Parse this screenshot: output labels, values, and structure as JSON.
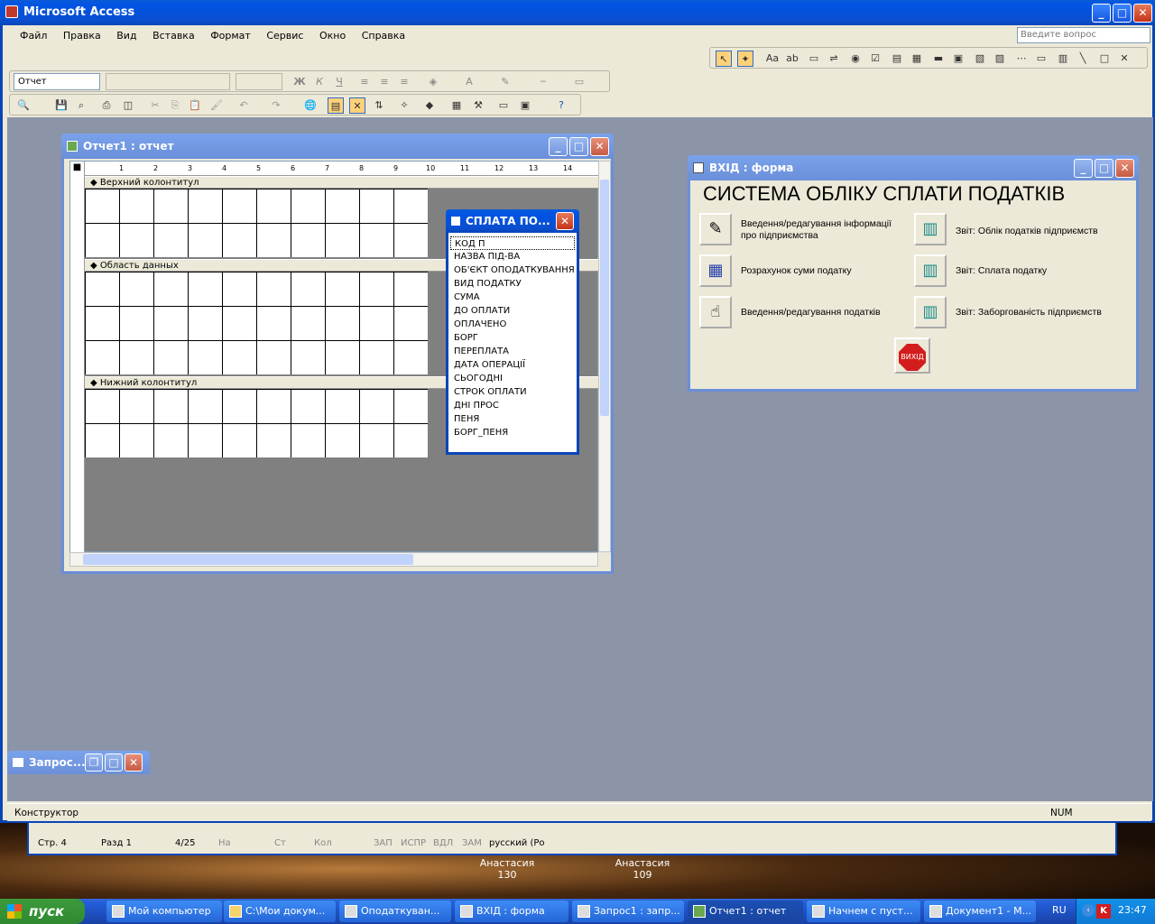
{
  "app": {
    "title": "Microsoft Access",
    "ask_placeholder": "Введите вопрос"
  },
  "menu": [
    "Файл",
    "Правка",
    "Вид",
    "Вставка",
    "Формат",
    "Сервис",
    "Окно",
    "Справка"
  ],
  "format_toolbar": {
    "object_value": "Отчет"
  },
  "report_window": {
    "title": "Отчет1 : отчет",
    "ruler": [
      "1",
      "2",
      "3",
      "4",
      "5",
      "6",
      "7",
      "8",
      "9",
      "10",
      "11",
      "12",
      "13",
      "14"
    ],
    "sections": [
      "Верхний колонтитул",
      "Область данных",
      "Нижний колонтитул"
    ]
  },
  "field_list": {
    "title": "СПЛАТА ПО...",
    "fields": [
      "КОД П",
      "НАЗВА ПІД-ВА",
      "ОБ'ЄКТ ОПОДАТКУВАННЯ",
      "ВИД ПОДАТКУ",
      "СУМА",
      "ДО ОПЛАТИ",
      "ОПЛАЧЕНО",
      "БОРГ",
      "ПЕРЕПЛАТА",
      "ДАТА ОПЕРАЦІЇ",
      "СЬОГОДНІ",
      "СТРОК ОПЛАТИ",
      "ДНІ ПРОС",
      "ПЕНЯ",
      "БОРГ_ПЕНЯ"
    ]
  },
  "form_window": {
    "title": "ВХІД : форма",
    "heading": "СИСТЕМА ОБЛІКУ СПЛАТИ ПОДАТКІВ",
    "left_items": [
      {
        "label": "Введення/редагування інформації про підприємства",
        "icon": "pencil-icon"
      },
      {
        "label": "Розрахунок суми податку",
        "icon": "calendar-icon"
      },
      {
        "label": "Введення/редагування податків",
        "icon": "hand-pointer-icon"
      }
    ],
    "right_items": [
      {
        "label": "Звіт: Облік податків підприємств",
        "icon": "notebook-icon"
      },
      {
        "label": "Звіт: Сплата податку",
        "icon": "notebook-icon"
      },
      {
        "label": "Звіт: Заборгованість підприємств",
        "icon": "notebook-icon"
      }
    ],
    "exit_label": "ВИХІД"
  },
  "minimized": {
    "title": "Запрос..."
  },
  "status": {
    "left": "Конструктор",
    "num": "NUM"
  },
  "word_status": {
    "page": "Стр. 4",
    "section": "Разд 1",
    "pages": "4/25",
    "at": "На",
    "line": "Ст",
    "col": "Кол",
    "rec": "ЗАП",
    "trk": "ИСПР",
    "ext": "ВДЛ",
    "ovr": "ЗАМ",
    "lang": "русский (Ро"
  },
  "desktop_labels": [
    {
      "name": "Анастасия",
      "num": "130"
    },
    {
      "name": "Анастасия",
      "num": "109"
    }
  ],
  "taskbar": {
    "start": "пуск",
    "items": [
      "Мой компьютер",
      "C:\\Мои докум...",
      "Оподаткуван...",
      "ВХІД : форма",
      "Запрос1 : запр...",
      "Отчет1 : отчет",
      "Начнем с пуст...",
      "Документ1 - М..."
    ],
    "lang": "RU",
    "time": "23:47"
  }
}
